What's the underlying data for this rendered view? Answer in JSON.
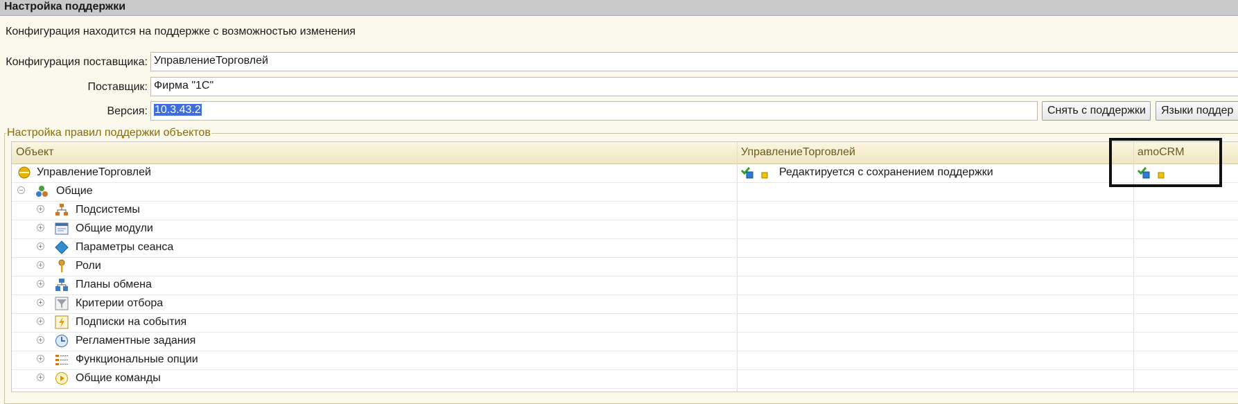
{
  "window": {
    "title": "Настройка поддержки"
  },
  "info_text": "Конфигурация находится на поддержке с возможностью изменения",
  "vendor_config": {
    "label": "Конфигурация поставщика:",
    "value": "УправлениеТорговлей"
  },
  "vendor": {
    "label": "Поставщик:",
    "value": "Фирма \"1С\""
  },
  "version": {
    "label": "Версия:",
    "value": "10.3.43.2"
  },
  "buttons": {
    "remove_support": "Снять с поддержки",
    "languages": "Языки поддер"
  },
  "group": {
    "title": "Настройка правил поддержки объектов"
  },
  "table": {
    "columns": [
      "Объект",
      "УправлениеТорговлей",
      "amoCRM"
    ],
    "root": {
      "name": "УправлениеТорговлей",
      "status": "Редактируется с сохранением поддержки"
    },
    "general": {
      "name": "Общие"
    },
    "children": [
      {
        "name": "Подсистемы",
        "icon": "subsystems-icon"
      },
      {
        "name": "Общие модули",
        "icon": "common-modules-icon"
      },
      {
        "name": "Параметры сеанса",
        "icon": "session-params-icon"
      },
      {
        "name": "Роли",
        "icon": "roles-key-icon"
      },
      {
        "name": "Планы обмена",
        "icon": "exchange-plans-icon"
      },
      {
        "name": "Критерии отбора",
        "icon": "filter-criteria-icon"
      },
      {
        "name": "Подписки на события",
        "icon": "event-subscriptions-icon"
      },
      {
        "name": "Регламентные задания",
        "icon": "scheduled-jobs-icon"
      },
      {
        "name": "Функциональные опции",
        "icon": "functional-options-icon"
      },
      {
        "name": "Общие команды",
        "icon": "common-commands-icon"
      }
    ]
  },
  "colors": {
    "titlebar": "#c9c9c9",
    "background": "#fbf9ec",
    "selection": "#3d6ee0",
    "highlight_frame": "#111111"
  }
}
